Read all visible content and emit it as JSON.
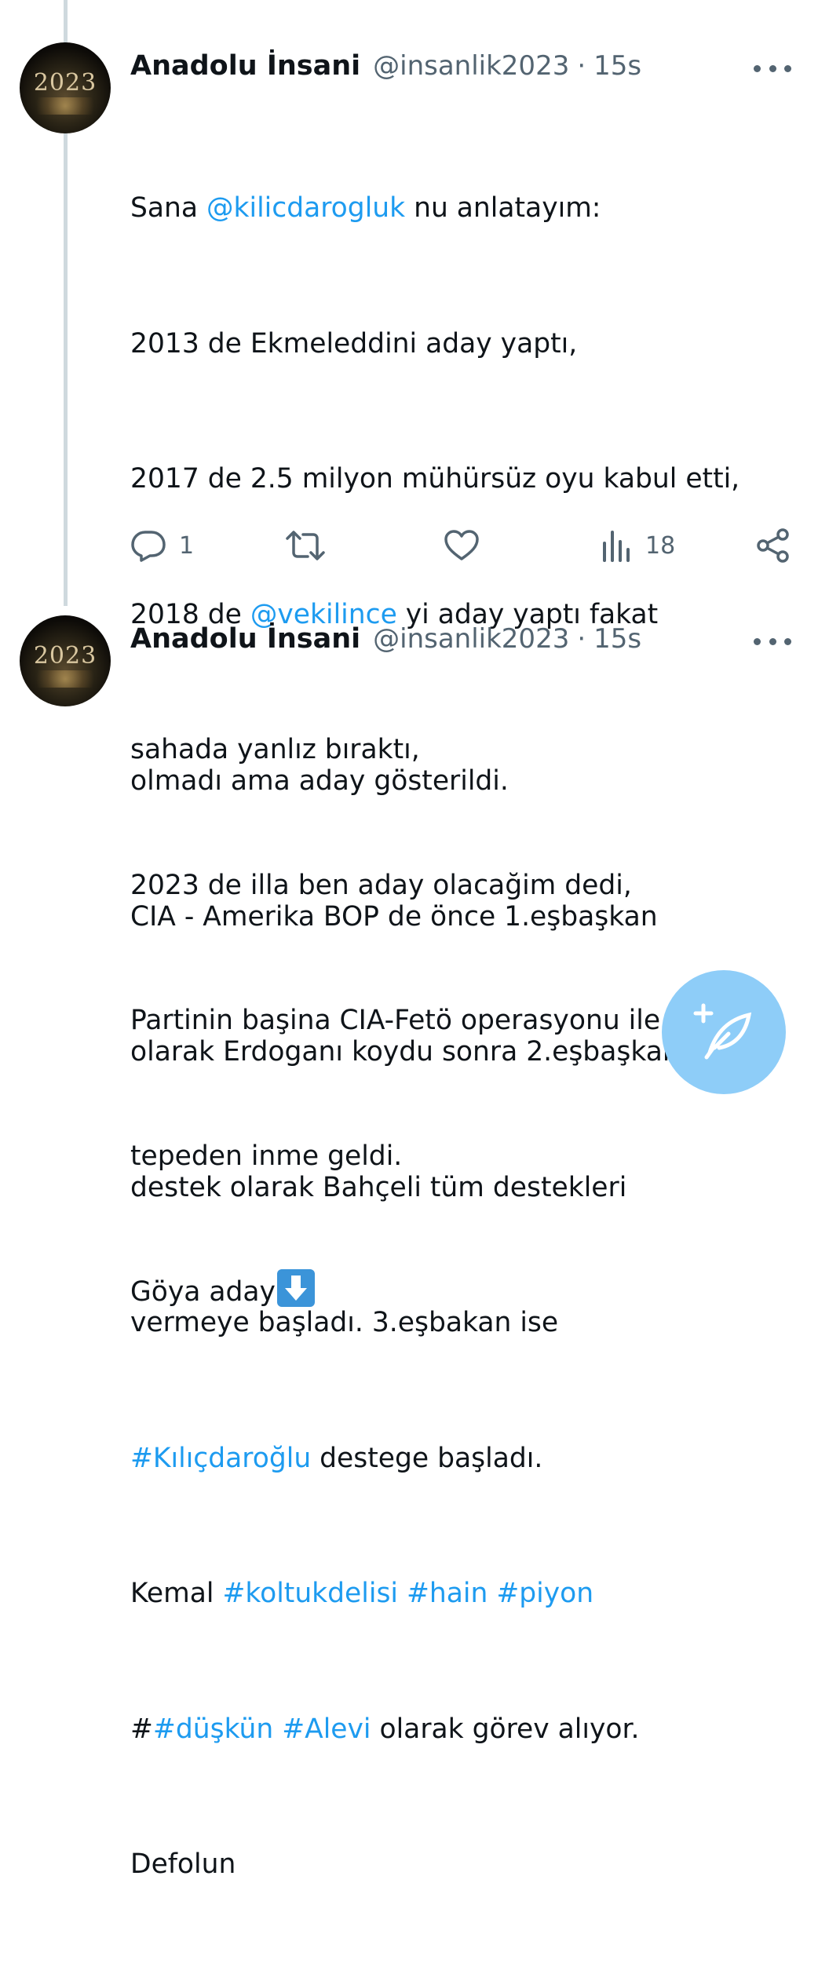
{
  "tweets": [
    {
      "author": {
        "display_name": "Anadolu İnsani",
        "handle": "@insanlik2023",
        "time": "15s",
        "avatar_text": "2023"
      },
      "body": {
        "line1": {
          "prefix": "Sana ",
          "mention": "@kilicdarogluk",
          "suffix": " nu anlatayım:"
        },
        "line2": "2013 de Ekmeleddini aday yaptı,",
        "line3": "2017 de 2.5 milyon mühürsüz oyu kabul etti,",
        "line4": {
          "prefix": "2018 de ",
          "mention": "@vekilince",
          "suffix": " yi aday yaptı fakat"
        },
        "line5": "sahada yanlız bıraktı,",
        "line6": "2023 de illa ben aday olacağim dedi,",
        "line7": "Partinin başina CIA-Fetö operasyonu ile",
        "line8": "tepeden inme geldi.",
        "line9": "Göya aday"
      },
      "stats": {
        "replies": "1",
        "views": "18"
      }
    },
    {
      "author": {
        "display_name": "Anadolu İnsani",
        "handle": "@insanlik2023",
        "time": "15s",
        "avatar_text": "2023"
      },
      "body": {
        "line1": "olmadı ama aday gösterildi.",
        "line2": "CIA - Amerika BOP de önce 1.eşbaşkan",
        "line3": "olarak Erdoganı koydu sonra 2.eşbaşkan",
        "line4": "destek olarak Bahçeli tüm destekleri",
        "line5": "vermeye başladı. 3.eşbakan ise",
        "line6": {
          "hashtag": "#Kılıçdaroğlu",
          "suffix": " destege başladı."
        },
        "line7": {
          "prefix": "Kemal ",
          "tag1": "#koltukdelisi",
          "tag2": "#hain",
          "tag3": "#piyon"
        },
        "line8": {
          "prefix": "#",
          "tag1": "#düşkün",
          "tag2": "#Alevi",
          "suffix": " olarak görev alıyor."
        },
        "line9": "Defolun"
      }
    }
  ],
  "icons": {
    "reply": "reply-icon",
    "retweet": "retweet-icon",
    "like": "like-icon",
    "views": "views-icon",
    "share": "share-icon",
    "more": "more-icon",
    "compose": "compose-tweet-icon",
    "emoji": "down-arrow-emoji"
  },
  "colors": {
    "link": "#1d9bf0",
    "secondary_text": "#536471",
    "thread_line": "#cfd9de",
    "fab": "#8ecdf8"
  }
}
